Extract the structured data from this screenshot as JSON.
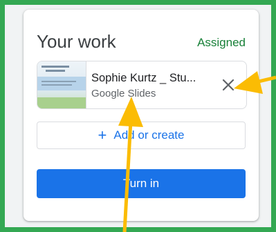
{
  "panel": {
    "title": "Your work",
    "status": "Assigned"
  },
  "attachment": {
    "name": "Sophie Kurtz _ Stu...",
    "type": "Google Slides",
    "remove_icon": "close-icon"
  },
  "actions": {
    "add_label": "Add or create",
    "add_icon": "plus-icon",
    "turn_in_label": "Turn in"
  },
  "colors": {
    "frame": "#34a853",
    "status": "#188038",
    "accent": "#1a73e8",
    "annotation_arrow": "#fbbc04"
  }
}
